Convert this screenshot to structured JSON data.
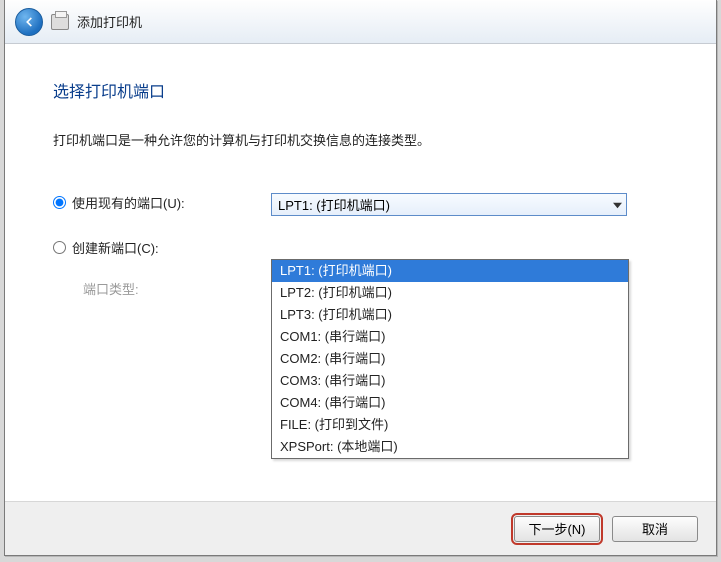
{
  "header": {
    "title": "添加打印机"
  },
  "page": {
    "heading": "选择打印机端口",
    "description": "打印机端口是一种允许您的计算机与打印机交换信息的连接类型。"
  },
  "radios": {
    "use_existing_label": "使用现有的端口(U):",
    "create_new_label": "创建新端口(C):",
    "port_type_label": "端口类型:"
  },
  "combo": {
    "selected": "LPT1: (打印机端口)",
    "options": [
      "LPT1: (打印机端口)",
      "LPT2: (打印机端口)",
      "LPT3: (打印机端口)",
      "COM1: (串行端口)",
      "COM2: (串行端口)",
      "COM3: (串行端口)",
      "COM4: (串行端口)",
      "FILE: (打印到文件)",
      "XPSPort: (本地端口)"
    ]
  },
  "footer": {
    "next": "下一步(N)",
    "cancel": "取消"
  },
  "close_glyph": "✕"
}
